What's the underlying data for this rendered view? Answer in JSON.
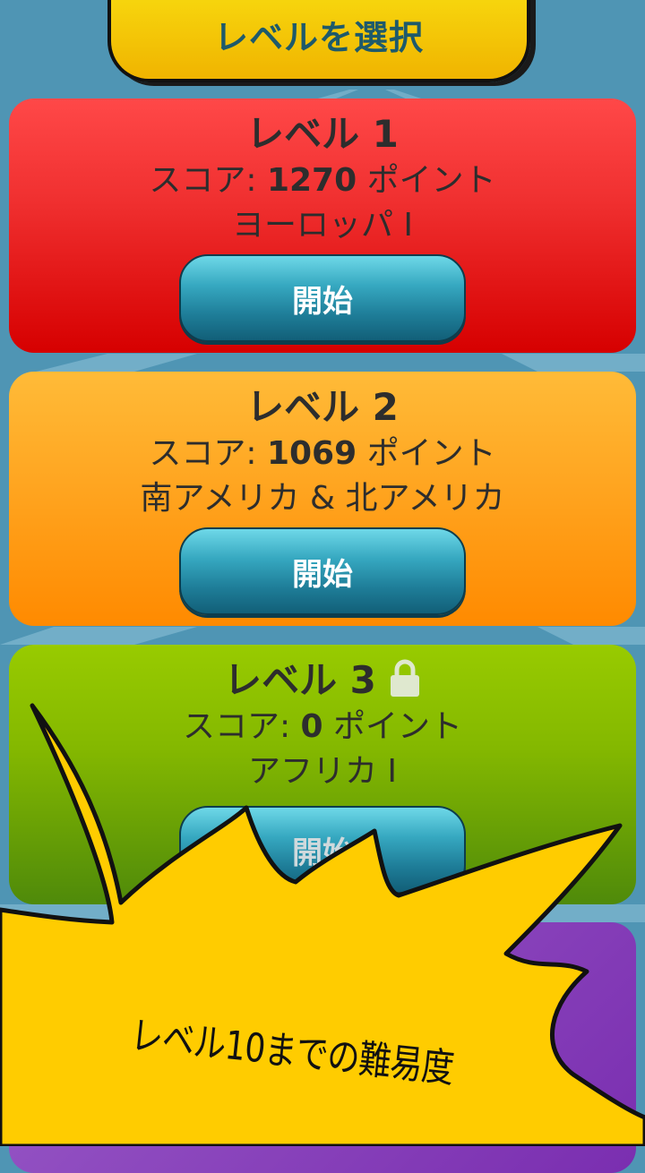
{
  "header": {
    "title": "レベルを選択"
  },
  "levels": [
    {
      "title": "レベル 1",
      "score_label": "スコア: ",
      "score_value": "1270",
      "score_unit": " ポイント",
      "region": "ヨーロッパ I",
      "start_label": "開始",
      "locked": false
    },
    {
      "title": "レベル 2",
      "score_label": "スコア: ",
      "score_value": "1069",
      "score_unit": " ポイント",
      "region": "南アメリカ & 北アメリカ",
      "start_label": "開始",
      "locked": false
    },
    {
      "title": "レベル 3",
      "score_label": "スコア: ",
      "score_value": "0",
      "score_unit": " ポイント",
      "region": "アフリカ I",
      "start_label": "開始",
      "locked": true,
      "lock_icon": "lock-icon"
    }
  ],
  "promo": {
    "text": "レベル10までの難易度"
  },
  "colors": {
    "background": "#4f95b4",
    "header": "#f8dc10",
    "level1": "#e82020",
    "level2": "#ffa520",
    "level3": "#84b800",
    "level4": "#8a44bc",
    "button": "#1e7d98",
    "burst": "#ffcc00"
  }
}
